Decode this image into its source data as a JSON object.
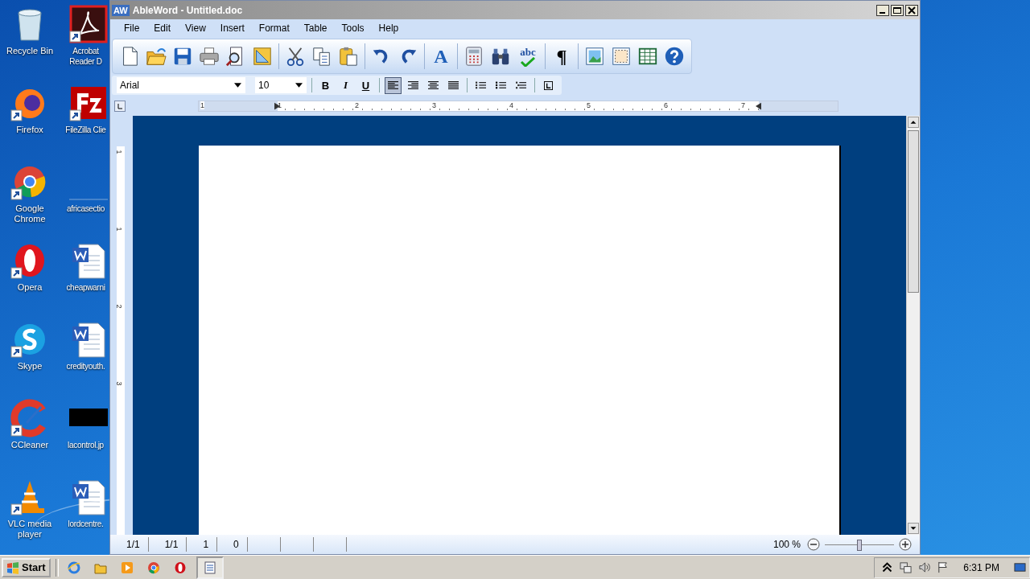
{
  "desktop_icons": [
    [
      {
        "kind": "recycle",
        "label": "Recycle Bin",
        "shortcut": false
      },
      {
        "kind": "firefox",
        "label": "Firefox",
        "shortcut": true
      },
      {
        "kind": "chrome",
        "label": "Google Chrome",
        "shortcut": true
      },
      {
        "kind": "opera",
        "label": "Opera",
        "shortcut": true
      },
      {
        "kind": "skype",
        "label": "Skype",
        "shortcut": true
      },
      {
        "kind": "ccleaner",
        "label": "CCleaner",
        "shortcut": true
      },
      {
        "kind": "vlc",
        "label": "VLC media player",
        "shortcut": true
      }
    ],
    [
      {
        "kind": "acrobat",
        "label": "Acrobat Reader D",
        "shortcut": true
      },
      {
        "kind": "filezilla",
        "label": "FileZilla Clie",
        "shortcut": true
      },
      {
        "kind": "blank",
        "label": "africasectio",
        "shortcut": false
      },
      {
        "kind": "worddoc",
        "label": "cheapwarni",
        "shortcut": false
      },
      {
        "kind": "worddoc",
        "label": "credityouth.",
        "shortcut": false
      },
      {
        "kind": "blackimage",
        "label": "lacontrol.jp",
        "shortcut": false
      },
      {
        "kind": "worddoc",
        "label": "lordcentre.",
        "shortcut": false
      }
    ]
  ],
  "window": {
    "logo": "AW",
    "title": "AbleWord - Untitled.doc",
    "menu": [
      "File",
      "Edit",
      "View",
      "Insert",
      "Format",
      "Table",
      "Tools",
      "Help"
    ],
    "toolbar": [
      [
        {
          "kind": "new"
        },
        {
          "kind": "open"
        },
        {
          "kind": "save"
        },
        {
          "kind": "print"
        },
        {
          "kind": "preview"
        },
        {
          "kind": "setsquare"
        }
      ],
      [
        {
          "kind": "cut"
        },
        {
          "kind": "copy"
        },
        {
          "kind": "paste"
        }
      ],
      [
        {
          "kind": "undo"
        },
        {
          "kind": "redo"
        }
      ],
      [
        {
          "kind": "font",
          "text": "A"
        }
      ],
      [
        {
          "kind": "calculator"
        },
        {
          "kind": "binoculars"
        },
        {
          "kind": "spell",
          "text": "abc"
        }
      ],
      [
        {
          "kind": "pilcrow",
          "text": "¶"
        }
      ],
      [
        {
          "kind": "image"
        },
        {
          "kind": "frame"
        },
        {
          "kind": "table"
        },
        {
          "kind": "help"
        }
      ]
    ],
    "format_bar": {
      "font": "Arial",
      "size": "10",
      "styles": [
        {
          "kind": "bold",
          "text": "B"
        },
        {
          "kind": "italic",
          "text": "I"
        },
        {
          "kind": "underline",
          "text": "U"
        }
      ],
      "align": [
        {
          "kind": "left",
          "selected": true
        },
        {
          "kind": "right",
          "selected": false
        },
        {
          "kind": "center",
          "selected": false
        },
        {
          "kind": "justify",
          "selected": false
        }
      ],
      "lists": [
        {
          "kind": "numbered"
        },
        {
          "kind": "bulleted"
        },
        {
          "kind": "multilevel"
        }
      ]
    },
    "ruler": [
      "1",
      "1",
      "2",
      "3",
      "4",
      "5",
      "6",
      "7"
    ],
    "vertical_ruler": [
      "1",
      "1",
      "2",
      "3"
    ],
    "status": [
      "1/1",
      "1/1",
      "1",
      "0"
    ],
    "zoom": {
      "text": "100 %",
      "level": 0.5
    }
  },
  "taskbar": {
    "start": "Start",
    "apps": [
      {
        "kind": "ie",
        "active": false
      },
      {
        "kind": "explorer",
        "active": false
      },
      {
        "kind": "media",
        "active": false
      },
      {
        "kind": "chrome",
        "active": false
      },
      {
        "kind": "opera",
        "active": false
      },
      {
        "kind": "ableword",
        "active": true
      }
    ],
    "clock": "6:31 PM"
  }
}
